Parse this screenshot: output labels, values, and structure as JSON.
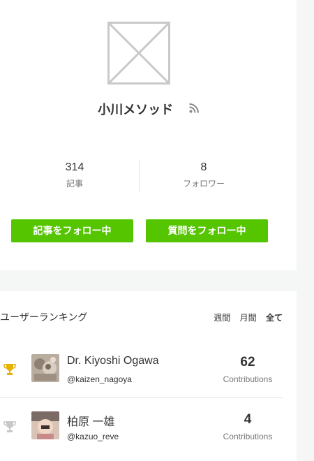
{
  "profile": {
    "name": "小川メソッド",
    "rss_icon": "rss-icon",
    "stats": [
      {
        "value": "314",
        "label": "記事"
      },
      {
        "value": "8",
        "label": "フォロワー"
      }
    ],
    "follow_articles_label": "記事をフォロー中",
    "follow_questions_label": "質問をフォロー中"
  },
  "ranking": {
    "title": "ユーザーランキング",
    "tabs": [
      {
        "label": "週間",
        "active": false
      },
      {
        "label": "月間",
        "active": false
      },
      {
        "label": "全て",
        "active": true
      }
    ],
    "users": [
      {
        "name": "Dr. Kiyoshi Ogawa",
        "handle": "@kaizen_nagoya",
        "contributions": "62",
        "contributions_label": "Contributions",
        "trophy": "gold-trophy-icon"
      },
      {
        "name": "柏原 一雄",
        "handle": "@kazuo_reve",
        "contributions": "4",
        "contributions_label": "Contributions",
        "trophy": "silver-trophy-icon"
      }
    ]
  },
  "colors": {
    "accent_green": "#55c500",
    "gold": "#e6b100",
    "silver": "#c8c8c8"
  }
}
